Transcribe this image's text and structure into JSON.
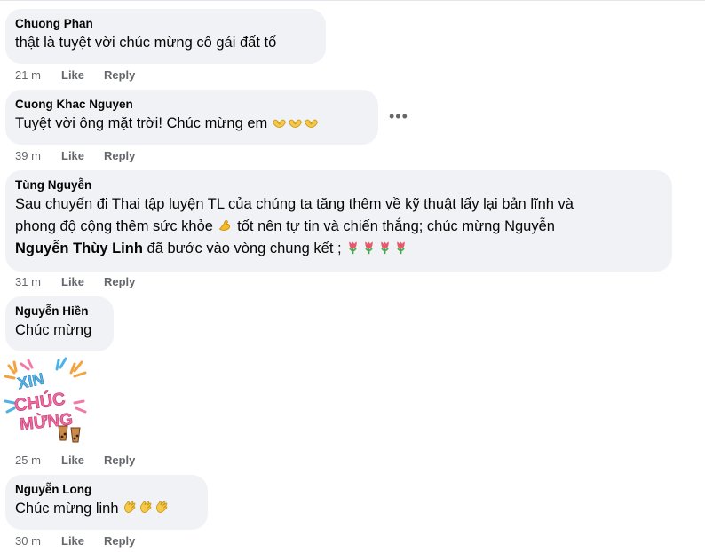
{
  "comments": [
    {
      "author": "Chuong Phan",
      "text": "thật là tuyệt vời chúc mừng cô gái đất tổ",
      "time": "21 m",
      "like": "Like",
      "reply": "Reply"
    },
    {
      "author": "Cuong Khac Nguyen",
      "text": "Tuyệt vời ông mặt trời! Chúc mừng em",
      "emoji": "heart-hands-icon",
      "time": "39 m",
      "like": "Like",
      "reply": "Reply"
    },
    {
      "author": "Tùng Nguyễn",
      "line1": "Sau chuyến đi Thai tập luyện TL của chúng ta tăng thêm về kỹ thuật lấy lại bản lĩnh và",
      "line2a": "phong độ cộng thêm sức khỏe",
      "emoji_a": "flexed-biceps-icon",
      "line2b": "tốt nên tự tin và chiến thắng; chúc mừng Nguyễn",
      "mention": "Nguyễn Thùy Linh",
      "line3": "đã bước vào vòng chung kết ;",
      "emoji_b": "tulip-icon",
      "time": "31 m",
      "like": "Like",
      "reply": "Reply"
    },
    {
      "author": "Nguyễn Hiền",
      "text": "Chúc mừng",
      "sticker_text": "XIN CHÚC MỪNG",
      "time": "25 m",
      "like": "Like",
      "reply": "Reply"
    },
    {
      "author": "Nguyễn Long",
      "text": "Chúc mừng linh",
      "emoji": "clapping-hands-icon",
      "time": "30 m",
      "like": "Like",
      "reply": "Reply"
    }
  ],
  "more_label": "•••",
  "colors": {
    "bubble": "#f0f2f5",
    "meta": "#65676b",
    "text": "#050505"
  }
}
